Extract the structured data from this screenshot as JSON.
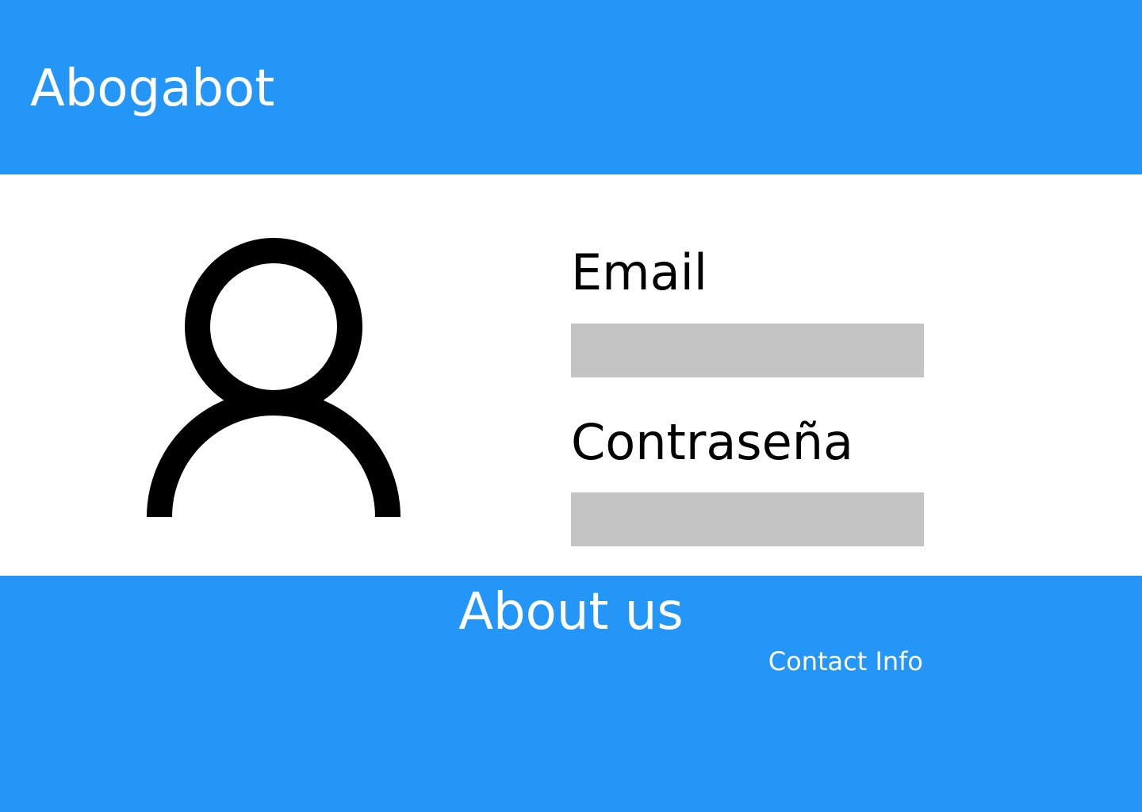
{
  "header": {
    "brand": "Abogabot",
    "background_color": "#2396F8"
  },
  "login": {
    "avatar_icon": "user-icon",
    "email_label": "Email",
    "email_value": "",
    "password_label": "Contraseña",
    "password_value": "",
    "input_color": "#C4C4C4"
  },
  "footer": {
    "about_label": "About us",
    "contact_label": "Contact Info",
    "background_color": "#2396F8"
  }
}
